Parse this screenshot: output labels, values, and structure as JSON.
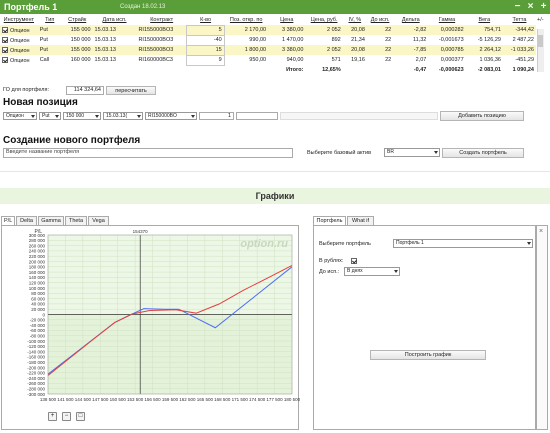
{
  "window": {
    "title": "Портфель 1",
    "created": "Создан 18.02.13",
    "min_icon": "minimize-icon",
    "close_icon": "close-icon",
    "add_icon": "add-icon",
    "extra": "+/-"
  },
  "table": {
    "headers": [
      "Инструмент",
      "Тип",
      "Страйк",
      "Дата исп.",
      "Контракт",
      "К-во",
      "Поз. откр. по",
      "Цена",
      "Цена, руб.",
      "IV, %",
      "До исп.",
      "Дельта",
      "Гамма",
      "Вега",
      "Тетта"
    ],
    "rows": [
      {
        "checked": true,
        "cells": [
          "Опцион",
          "Put",
          "155 000",
          "15.03.13",
          "RI155000BO3",
          "5",
          "2 170,00",
          "3 380,00",
          "2 052",
          "20,08",
          "22",
          "-2,82",
          "0,000282",
          "754,71",
          "-344,42"
        ],
        "style": "y"
      },
      {
        "checked": true,
        "cells": [
          "Опцион",
          "Put",
          "150 000",
          "15.03.13",
          "RI150000BO3",
          "-40",
          "990,00",
          "1 470,00",
          "892",
          "21,34",
          "22",
          "11,32",
          "-0,001673",
          "-5 126,29",
          "2 487,22"
        ],
        "style": "w"
      },
      {
        "checked": true,
        "cells": [
          "Опцион",
          "Put",
          "155 000",
          "15.03.13",
          "RI155000BO3",
          "15",
          "1 800,00",
          "3 380,00",
          "2 052",
          "20,08",
          "22",
          "-7,85",
          "0,000785",
          "2 264,12",
          "-1 033,26"
        ],
        "style": "y"
      },
      {
        "checked": true,
        "cells": [
          "Опцион",
          "Call",
          "160 000",
          "15.03.13",
          "RI160000BC3",
          "9",
          "950,00",
          "940,00",
          "571",
          "19,16",
          "22",
          "2,07",
          "0,000377",
          "1 036,36",
          "-451,29"
        ],
        "style": "w"
      }
    ],
    "total_label": "Итого:",
    "total_pct": "12,65%",
    "totals": [
      "-0,47",
      "-0,000623",
      "-2 083,01",
      "1 090,24"
    ]
  },
  "go": {
    "label": "ГО для портфеля:",
    "value": "114 324,64",
    "recalc_button": "пересчитать"
  },
  "new_position": {
    "heading": "Новая позиция",
    "type_select": "Опцион",
    "kind_select": "Put",
    "strike_select": "150 000",
    "date_select": "15.03.13(",
    "contract_select": "RI150000BO",
    "qty_value": "1",
    "add_button": "Добавить позицию"
  },
  "new_portfolio": {
    "heading": "Создание нового портфеля",
    "name_placeholder": "Введите название портфеля",
    "base_label": "Выберите базовый актив",
    "base_select": "BR",
    "create_button": "Создать портфель"
  },
  "graphs": {
    "title": "Графики",
    "tabs": [
      "P/L",
      "Delta",
      "Gamma",
      "Theta",
      "Vega"
    ],
    "right_tabs": [
      "Портфель",
      "What if"
    ],
    "select_portfolio_label": "Выберите портфель",
    "select_portfolio_value": "Портфель 1",
    "rub_label": "В рублях:",
    "to_exp_label": "До исп.:",
    "to_exp_value": "В днях",
    "build_button": "Построить график"
  },
  "chart_data": {
    "type": "line",
    "ylabel": "P/L",
    "watermark": "option.ru",
    "marker_label": "154370",
    "marker_x": 154370,
    "xlim": [
      138500,
      180500
    ],
    "ylim": [
      -300000,
      300000
    ],
    "x_ticks": [
      "138 500",
      "141 500",
      "144 500",
      "147 500",
      "150 500",
      "153 500",
      "156 500",
      "159 500",
      "162 500",
      "165 500",
      "168 500",
      "171 500",
      "174 500",
      "177 500",
      "180 500"
    ],
    "y_ticks": [
      "300 000",
      "280 000",
      "260 000",
      "240 000",
      "220 000",
      "200 000",
      "180 000",
      "160 000",
      "140 000",
      "120 000",
      "100 000",
      "80 000",
      "60 000",
      "40 000",
      "20 000",
      "0",
      "-20 000",
      "-40 000",
      "-60 000",
      "-80 000",
      "-100 000",
      "-120 000",
      "-140 000",
      "-160 000",
      "-180 000",
      "-200 000",
      "-220 000",
      "-240 000",
      "-260 000",
      "-280 000",
      "-300 000"
    ],
    "series": [
      {
        "color": "#4d6ef5",
        "x": [
          138500,
          150000,
          152300,
          155000,
          158500,
          161000,
          167300,
          180500
        ],
        "y": [
          -225000,
          -30000,
          -5000,
          22000,
          20000,
          20000,
          -50000,
          180000
        ]
      },
      {
        "color": "#e04040",
        "x": [
          138500,
          142500,
          146500,
          150000,
          153000,
          156000,
          160500,
          164000,
          168000,
          172000,
          176500,
          180500
        ],
        "y": [
          -230000,
          -160000,
          -90000,
          -30000,
          2000,
          15000,
          18000,
          5000,
          40000,
          90000,
          140000,
          185000
        ]
      }
    ],
    "grid": true
  }
}
